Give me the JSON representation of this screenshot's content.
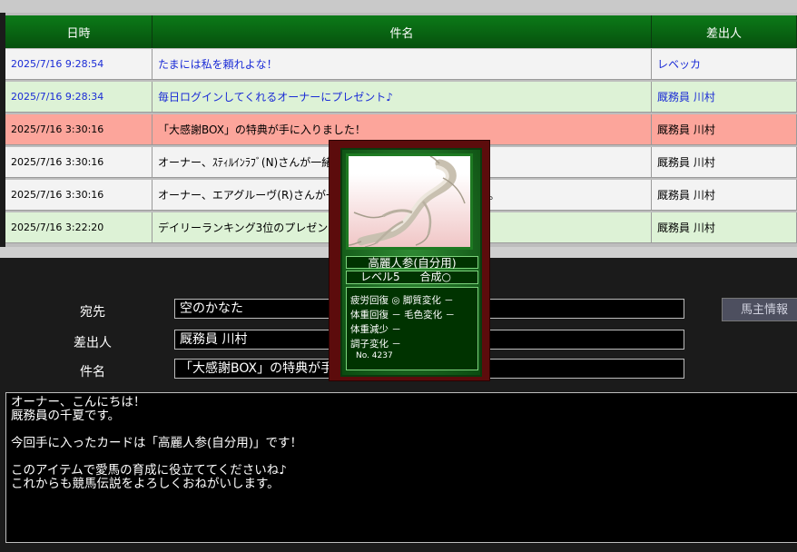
{
  "table": {
    "headers": {
      "date": "日時",
      "subject": "件名",
      "sender": "差出人"
    },
    "rows": [
      {
        "date": "2025/7/16 9:28:54",
        "subject": "たまには私を頼れよな！",
        "sender": "レベッカ",
        "bg": "#f3f3f3",
        "color": "#1a2bd6"
      },
      {
        "date": "2025/7/16 9:28:34",
        "subject": "毎日ログインしてくれるオーナーにプレゼント♪",
        "sender": "厩務員 川村",
        "bg": "#ddf2d6",
        "color": "#1a2bd6"
      },
      {
        "date": "2025/7/16 3:30:16",
        "subject": "「大感謝BOX」の特典が手に入りました！",
        "sender": "厩務員 川村",
        "bg": "#fca59b",
        "color": "#000000"
      },
      {
        "date": "2025/7/16 3:30:16",
        "subject": "オーナー、ｽﾃｨﾙｲﾝﾗﾌﾞ(N)さんが一緒に走りたいと言っています。",
        "sender": "厩務員 川村",
        "bg": "#f3f3f3",
        "color": "#000000"
      },
      {
        "date": "2025/7/16 3:30:16",
        "subject": "オーナー、エアグルーヴ(R)さんが一緒に走りたいと言っていました。",
        "sender": "厩務員 川村",
        "bg": "#f3f3f3",
        "color": "#000000"
      },
      {
        "date": "2025/7/16 3:22:20",
        "subject": "デイリーランキング3位のプレゼントです！",
        "sender": "厩務員 川村",
        "bg": "#ddf2d6",
        "color": "#000000"
      }
    ]
  },
  "form": {
    "to_label": "宛先",
    "to_value": "空のかなた",
    "from_label": "差出人",
    "from_value": "厩務員 川村",
    "subject_label": "件名",
    "subject_value": "「大感謝BOX」の特典が手に入りました！",
    "owner_button": "馬主情報"
  },
  "message": {
    "lines": [
      "オーナー、こんにちは！",
      "厩務員の千夏です。",
      "",
      "今回手に入ったカードは「高麗人参(自分用)」です！",
      "",
      "このアイテムで愛馬の育成に役立ててくださいね♪",
      "これからも競馬伝説をよろしくおねがいします。"
    ]
  },
  "card": {
    "name": "高麗人参(自分用)",
    "level": "レベル5",
    "synth": "合成○",
    "stat1": "疲労回復 ◎ 脚質変化 －",
    "stat2": "体重回復 － 毛色変化 －",
    "stat3": "体重減少 －",
    "stat4": "調子変化 －",
    "number": "No. 4237"
  },
  "colors": {
    "header_green": "#0c7a18",
    "card_border": "#5c0c0c",
    "link_blue": "#1a2bd6"
  }
}
